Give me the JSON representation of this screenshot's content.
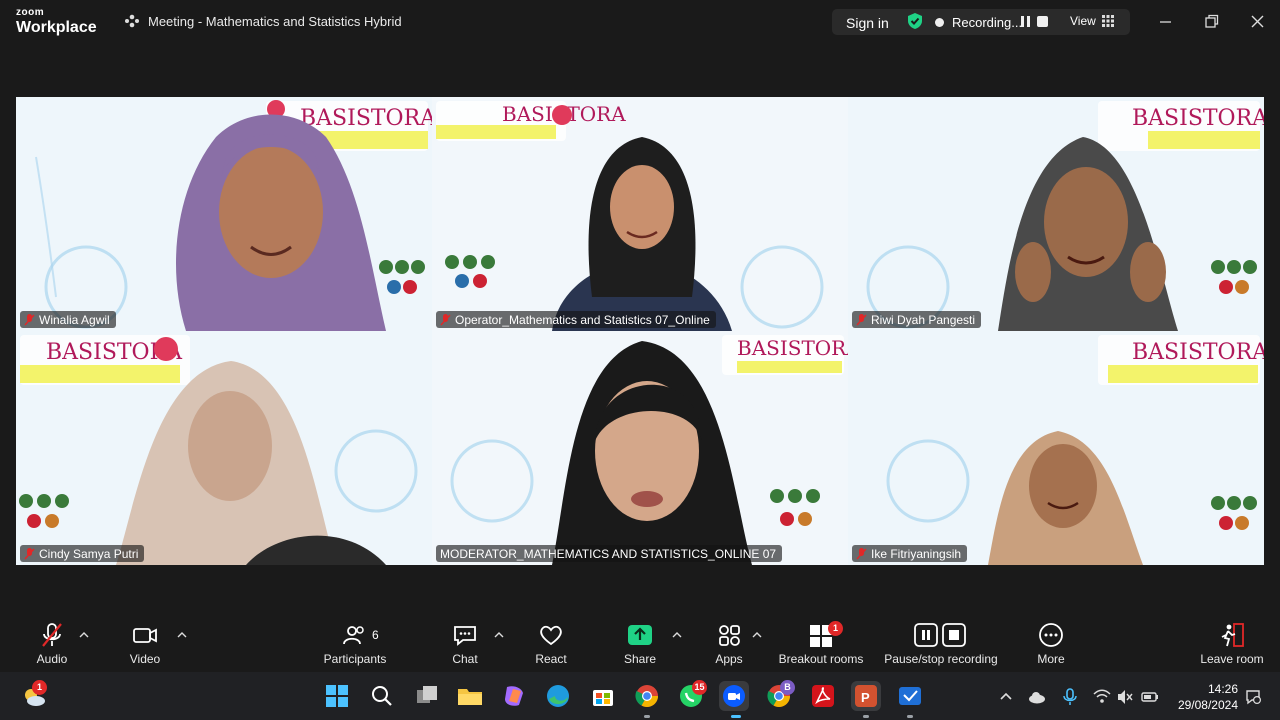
{
  "app": {
    "brand_top": "zoom",
    "brand_bottom": "Workplace",
    "meeting_title": "Meeting - Mathematics and Statistics Hybrid"
  },
  "topbar": {
    "sign_in": "Sign in",
    "recording": "Recording...",
    "view": "View"
  },
  "participants": [
    {
      "name": "Winalia Agwil",
      "active": false
    },
    {
      "name": "Operator_Mathematics and Statistics 07_Online",
      "active": false
    },
    {
      "name": "Riwi Dyah Pangesti",
      "active": false
    },
    {
      "name": "Cindy Samya Putri",
      "active": false
    },
    {
      "name": "MODERATOR_MATHEMATICS AND STATISTICS_ONLINE 07",
      "active": true
    },
    {
      "name": "Ike Fitriyaningsih",
      "active": false
    }
  ],
  "background_banner": {
    "logo_text": "BASISTORA"
  },
  "controls": {
    "audio": "Audio",
    "video": "Video",
    "participants": "Participants",
    "participants_count": "6",
    "chat": "Chat",
    "react": "React",
    "share": "Share",
    "apps": "Apps",
    "breakout": "Breakout rooms",
    "breakout_badge": "1",
    "pause_recording": "Pause/stop recording",
    "more": "More",
    "leave": "Leave room"
  },
  "taskbar": {
    "time": "14:26",
    "date": "29/08/2024",
    "whatsapp_badge": "15",
    "chrome_badge": "B",
    "weather_badge": "1"
  },
  "colors": {
    "accent_green": "#1fd286",
    "share_green": "#1fd286",
    "badge_red": "#e02828"
  }
}
